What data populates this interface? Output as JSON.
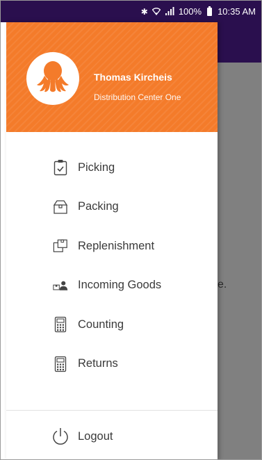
{
  "status_bar": {
    "battery": "100%",
    "time": "10:35 AM",
    "icons": [
      "bluetooth-icon",
      "wifi-icon",
      "signal-icon",
      "battery-icon"
    ]
  },
  "colors": {
    "accent": "#f47b2a",
    "appbar": "#2a0f4e",
    "scrim": "#808080"
  },
  "background": {
    "text_fragment": "e."
  },
  "drawer": {
    "user": {
      "name": "Thomas Kircheis",
      "location": "Distribution Center One",
      "avatar_icon": "octopus-logo-icon"
    },
    "items": [
      {
        "label": "Picking",
        "icon": "clipboard-check-icon"
      },
      {
        "label": "Packing",
        "icon": "box-icon"
      },
      {
        "label": "Replenishment",
        "icon": "stacked-boxes-icon"
      },
      {
        "label": "Incoming Goods",
        "icon": "delivery-person-icon"
      },
      {
        "label": "Counting",
        "icon": "calculator-icon"
      },
      {
        "label": "Returns",
        "icon": "calculator-icon"
      }
    ],
    "logout": {
      "label": "Logout",
      "icon": "power-icon"
    }
  }
}
